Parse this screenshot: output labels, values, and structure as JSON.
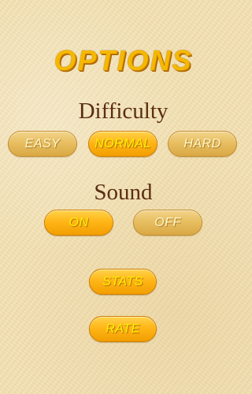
{
  "title": "OPTIONS",
  "difficulty": {
    "heading": "Difficulty",
    "options": [
      {
        "label": "EASY",
        "selected": false
      },
      {
        "label": "NORMAL",
        "selected": true
      },
      {
        "label": "HARD",
        "selected": false
      }
    ]
  },
  "sound": {
    "heading": "Sound",
    "options": [
      {
        "label": "ON",
        "selected": true
      },
      {
        "label": "OFF",
        "selected": false
      }
    ]
  },
  "buttons": {
    "stats": "STATS",
    "rate": "RATE"
  },
  "colors": {
    "background": "#f3e2b5",
    "title": "#f5b800",
    "heading": "#5a2d12",
    "button_selected": "#ffb618",
    "button_unselected": "#e8bf62"
  }
}
